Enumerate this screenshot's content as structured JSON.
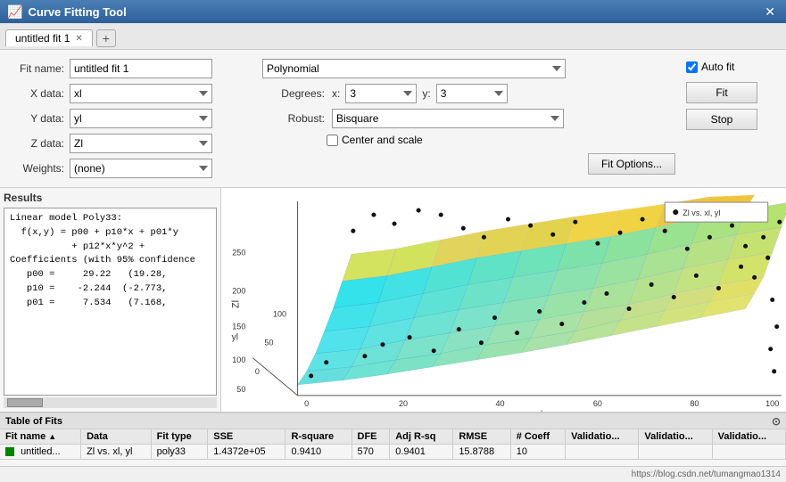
{
  "titleBar": {
    "icon": "📈",
    "title": "Curve Fitting Tool",
    "closeBtn": "✕"
  },
  "tabs": [
    {
      "label": "untitled fit 1",
      "active": true
    }
  ],
  "addTabLabel": "+",
  "form": {
    "fitNameLabel": "Fit name:",
    "fitNameValue": "untitled fit 1",
    "xDataLabel": "X data:",
    "xDataValue": "xl",
    "yDataLabel": "Y data:",
    "yDataValue": "yl",
    "zDataLabel": "Z data:",
    "zDataValue": "Zl",
    "weightsLabel": "Weights:",
    "weightsValue": "(none)"
  },
  "options": {
    "fitTypeLabel": "",
    "fitTypeValue": "Polynomial",
    "degreesLabel": "Degrees:",
    "xLabel": "x:",
    "xValue": "3",
    "yLabel": "y:",
    "yValue": "3",
    "robustLabel": "Robust:",
    "robustValue": "Bisquare",
    "centerScaleLabel": "Center and scale",
    "fitOptionsBtn": "Fit Options..."
  },
  "buttons": {
    "autoFitLabel": "Auto fit",
    "fitLabel": "Fit",
    "stopLabel": "Stop"
  },
  "results": {
    "title": "Results",
    "content": "Linear model Poly33:\n  f(x,y) = p00 + p10*x + p01*y\n           + p12*x*y^2 +\nCoefficients (with 95% confidence\n   p00 =     29.22   (19.28,\n   p10 =    -2.244  (-2.773,\n   p01 =     7.534   (7.168,"
  },
  "plot": {
    "legend": "Zl vs. xl, yl",
    "xAxisLabel": "xl",
    "yAxisLabel": "yl",
    "zAxisLabel": "Zl",
    "xTicks": [
      "0",
      "20",
      "40",
      "60",
      "80",
      "100"
    ],
    "yTicks": [
      "0",
      "50",
      "100"
    ],
    "zTicks": [
      "50",
      "100",
      "150",
      "200",
      "250"
    ]
  },
  "tableOfFits": {
    "title": "Table of Fits",
    "columns": [
      "Fit name",
      "Data",
      "Fit type",
      "SSE",
      "R-square",
      "DFE",
      "Adj R-sq",
      "RMSE",
      "# Coeff",
      "Validatio...",
      "Validatio...",
      "Validatio..."
    ],
    "rows": [
      {
        "color": "green",
        "fitName": "untitled...",
        "data": "Zl vs. xl, yl",
        "fitType": "poly33",
        "sse": "1.4372e+05",
        "rsquare": "0.9410",
        "dfe": "570",
        "adjRsq": "0.9401",
        "rmse": "15.8788",
        "nCoeff": "10",
        "val1": "",
        "val2": "",
        "val3": ""
      }
    ]
  },
  "statusBar": {
    "url": "https://blog.csdn.net/tumangmao1314"
  }
}
